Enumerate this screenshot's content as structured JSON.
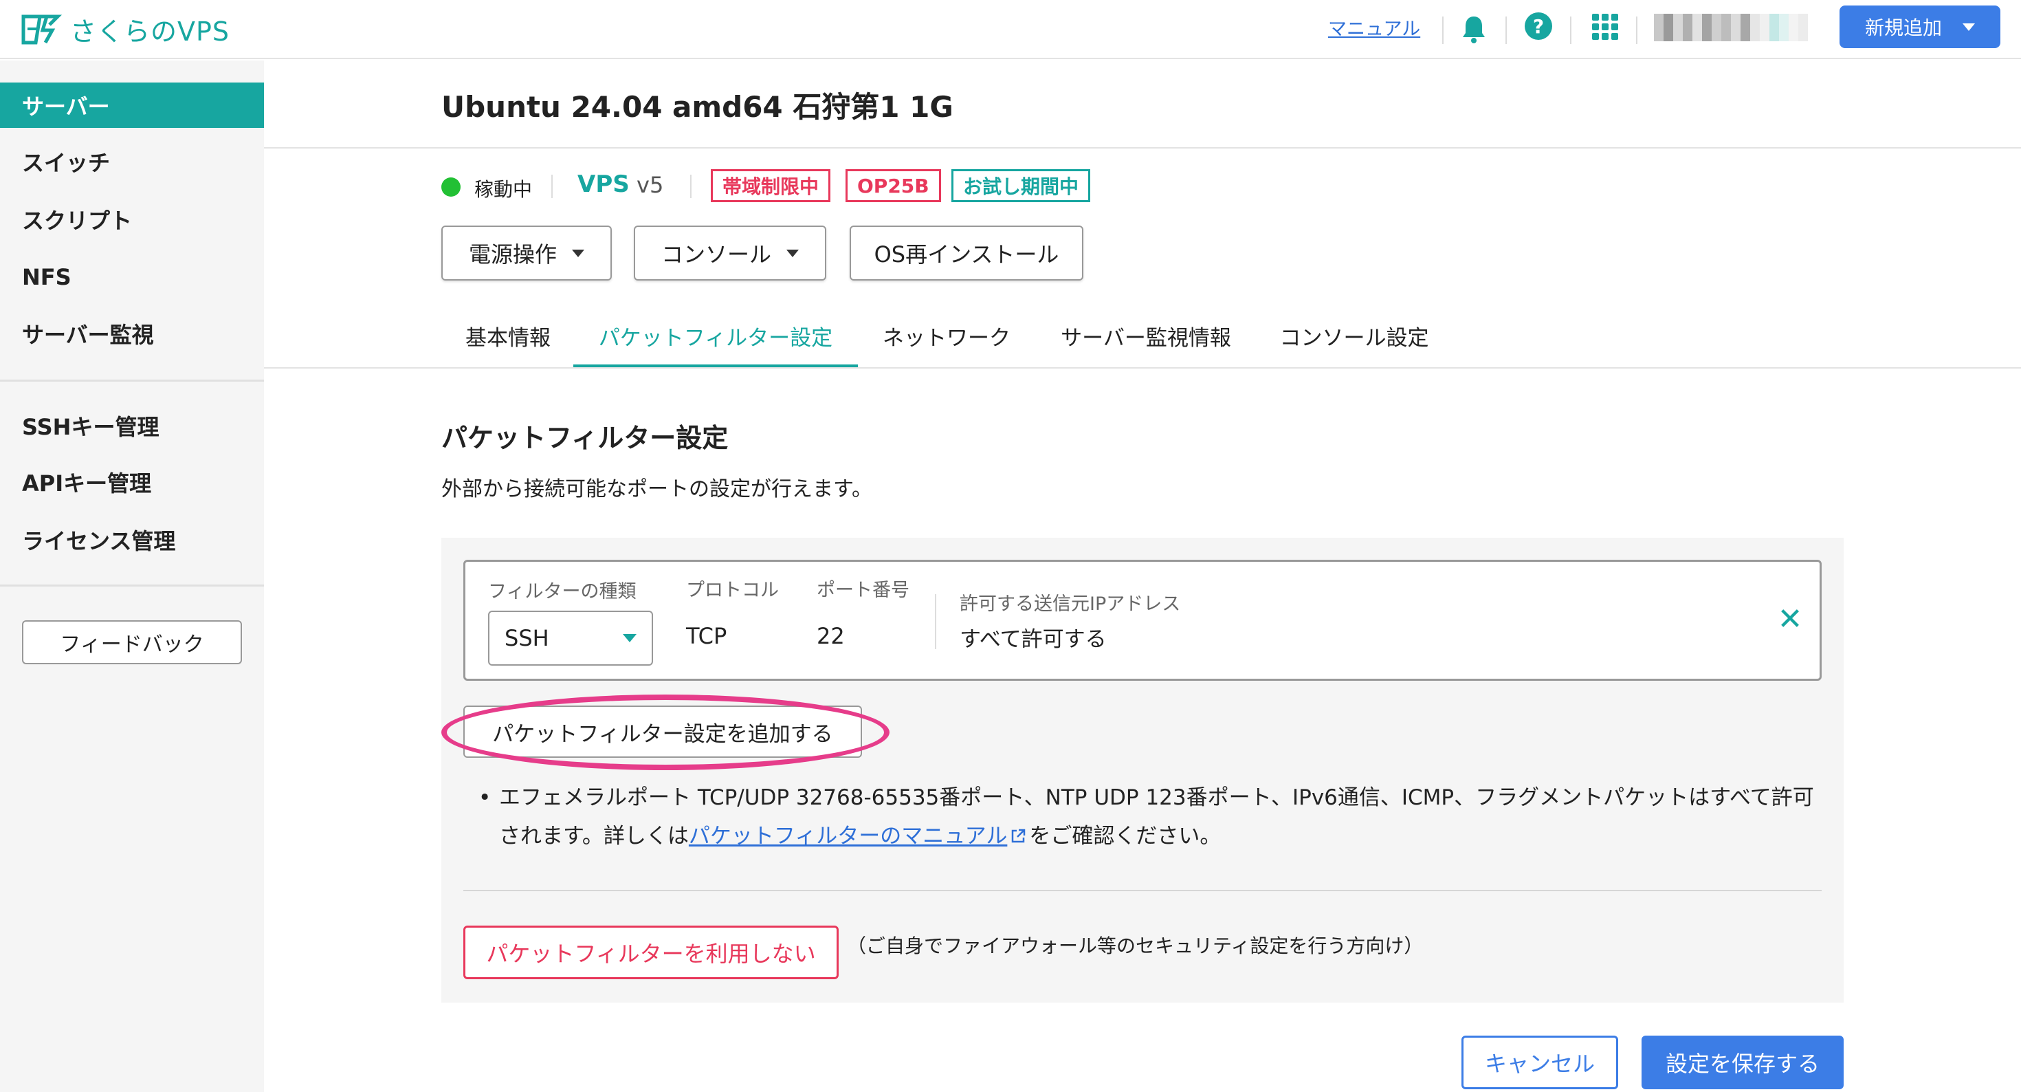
{
  "header": {
    "logo_text": "さくらのVPS",
    "manual_link": "マニュアル",
    "new_add_label": "新規追加"
  },
  "sidebar": {
    "items": [
      {
        "label": "サーバー",
        "active": true
      },
      {
        "label": "スイッチ"
      },
      {
        "label": "スクリプト"
      },
      {
        "label": "NFS"
      },
      {
        "label": "サーバー監視"
      },
      {
        "label": "SSHキー管理"
      },
      {
        "label": "APIキー管理"
      },
      {
        "label": "ライセンス管理"
      }
    ],
    "feedback_label": "フィードバック"
  },
  "server": {
    "title": "Ubuntu 24.04 amd64 石狩第1 1G",
    "status": "稼動中",
    "plan": "VPS",
    "version": "v5",
    "badges": [
      "帯域制限中",
      "OP25B",
      "お試し期間中"
    ]
  },
  "actions": {
    "power_label": "電源操作",
    "console_label": "コンソール",
    "reinstall_label": "OS再インストール"
  },
  "tabs": [
    {
      "label": "基本情報"
    },
    {
      "label": "パケットフィルター設定",
      "active": true
    },
    {
      "label": "ネットワーク"
    },
    {
      "label": "サーバー監視情報"
    },
    {
      "label": "コンソール設定"
    }
  ],
  "section": {
    "title": "パケットフィルター設定",
    "description": "外部から接続可能なポートの設定が行えます。"
  },
  "filter": {
    "type_label": "フィルターの種類",
    "type_value": "SSH",
    "protocol_label": "プロトコル",
    "protocol_value": "TCP",
    "port_label": "ポート番号",
    "port_value": "22",
    "source_label": "許可する送信元IPアドレス",
    "source_value": "すべて許可する"
  },
  "add_filter_label": "パケットフィルター設定を追加する",
  "note": {
    "bullet": "•",
    "text_before": "エフェメラルポート TCP/UDP 32768-65535番ポート、NTP UDP 123番ポート、IPv6通信、ICMP、フラグメントパケットはすべて許可されます。詳しくは",
    "link": "パケットフィルターのマニュアル",
    "text_after": "をご確認ください。"
  },
  "disable_filter_label": "パケットフィルターを利用しない",
  "disable_note": "（ご自身でファイアウォール等のセキュリティ設定を行う方向け）",
  "footer": {
    "cancel_label": "キャンセル",
    "save_label": "設定を保存する"
  },
  "colors": {
    "brand": "#17a6a0",
    "primary": "#3c7de6",
    "danger": "#e8385b",
    "highlight": "#e63c8a",
    "status_ok": "#22c034"
  },
  "icons": [
    "sakura-logo-icon",
    "bell-icon",
    "help-icon",
    "apps-grid-icon",
    "chevron-down-icon",
    "close-icon",
    "external-link-icon"
  ]
}
